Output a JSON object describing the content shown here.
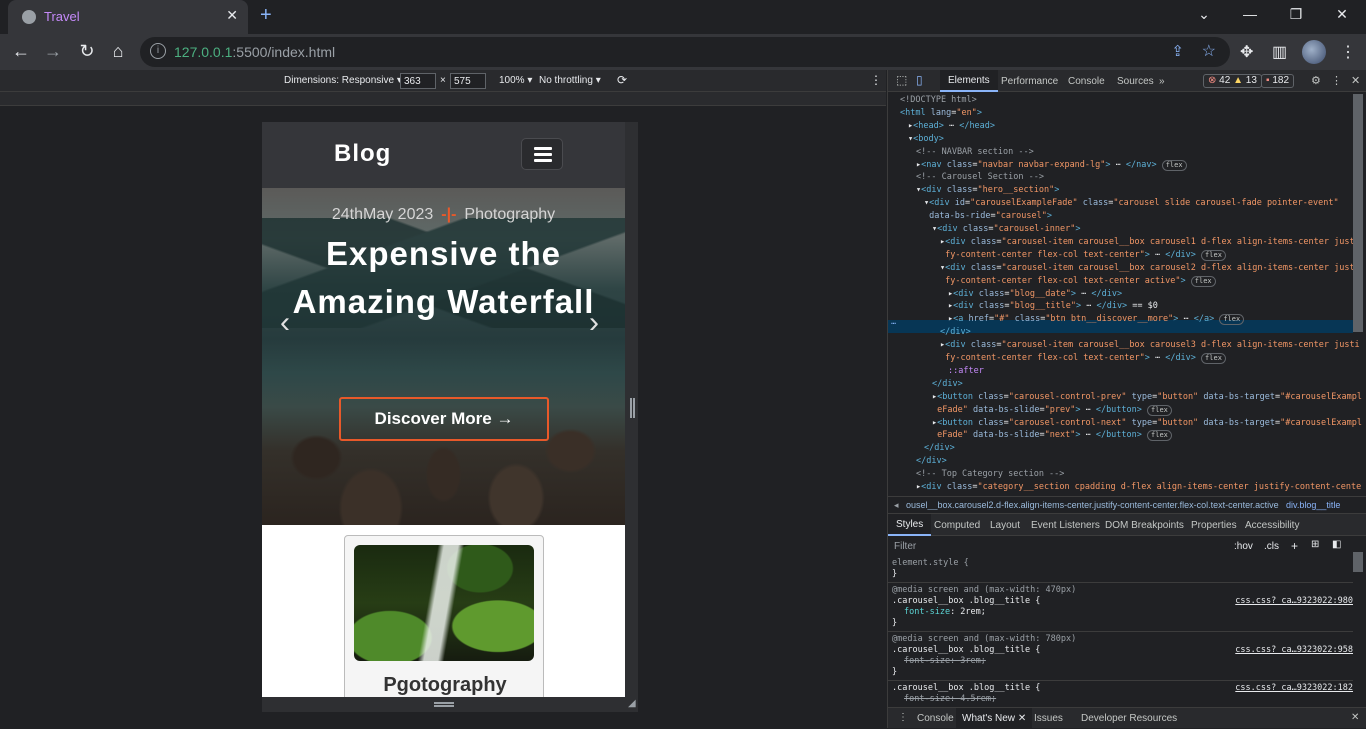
{
  "browser": {
    "tab_title": "Travel",
    "tab_close": "✕",
    "new_tab": "+",
    "url_host": "127.0.0.1",
    "url_rest": ":5500/index.html",
    "window_controls": [
      "⌄",
      "—",
      "❐",
      "✕"
    ]
  },
  "device_toolbar": {
    "dimensions_label": "Dimensions: Responsive ▾",
    "width": "363",
    "times": "×",
    "height": "575",
    "zoom": "100% ▾",
    "throttling": "No throttling ▾"
  },
  "page": {
    "brand": "Blog",
    "hero_date": "24thMay 2023",
    "hero_sep": "-|-",
    "hero_category": "Photography",
    "hero_title": "Expensive the Amazing Waterfall",
    "hero_button": "Discover More",
    "hero_button_arrow": "→",
    "prev": "‹",
    "next": "›",
    "card_title": "Pgotography"
  },
  "devtools": {
    "tabs": [
      "Elements",
      "Performance",
      "Console",
      "Sources",
      "»"
    ],
    "errors": "42",
    "warnings": "13",
    "issues": "182",
    "dom_lines": [
      {
        "i": 0,
        "html": "<span class='cm'>&lt;!DOCTYPE html&gt;</span>"
      },
      {
        "i": 0,
        "html": "<span class='tag'>&lt;html</span> <span class='attr'>lang</span>=<span class='val'>\"en\"</span><span class='tag'>&gt;</span>"
      },
      {
        "i": 1,
        "html": "▸<span class='tag'>&lt;head&gt;</span> ⋯ <span class='tag'>&lt;/head&gt;</span>"
      },
      {
        "i": 1,
        "html": "▾<span class='tag'>&lt;body&gt;</span>"
      },
      {
        "i": 2,
        "html": "<span class='cm'>&lt;!-- NAVBAR section --&gt;</span>"
      },
      {
        "i": 2,
        "html": "▸<span class='tag'>&lt;nav</span> <span class='attr'>class</span>=<span class='val'>\"navbar navbar-expand-lg\"</span><span class='tag'>&gt;</span> ⋯ <span class='tag'>&lt;/nav&gt;</span> <span class='flexb'>flex</span>"
      },
      {
        "i": 2,
        "html": "<span class='cm'>&lt;!-- Carousel Section --&gt;</span>"
      },
      {
        "i": 2,
        "html": "▾<span class='tag'>&lt;div</span> <span class='attr'>class</span>=<span class='val'>\"hero__section\"</span><span class='tag'>&gt;</span>"
      },
      {
        "i": 3,
        "html": "▾<span class='tag'>&lt;div</span> <span class='attr'>id</span>=<span class='val'>\"carouselExampleFade\"</span> <span class='attr'>class</span>=<span class='val'>\"carousel slide carousel-fade pointer-event\"</span>"
      },
      {
        "i": 3,
        "html": "&nbsp;<span class='attr'>data-bs-ride</span>=<span class='val'>\"carousel\"</span><span class='tag'>&gt;</span>"
      },
      {
        "i": 4,
        "html": "▾<span class='tag'>&lt;div</span> <span class='attr'>class</span>=<span class='val'>\"carousel-inner\"</span><span class='tag'>&gt;</span>"
      },
      {
        "i": 5,
        "html": "▸<span class='tag'>&lt;div</span> <span class='attr'>class</span>=<span class='val'>\"carousel-item carousel__box carousel1 d-flex align-items-center justi</span>"
      },
      {
        "i": 5,
        "html": "&nbsp;<span class='val'>fy-content-center flex-col text-center\"</span><span class='tag'>&gt;</span> ⋯ <span class='tag'>&lt;/div&gt;</span> <span class='flexb'>flex</span>"
      },
      {
        "i": 5,
        "html": "▾<span class='tag'>&lt;div</span> <span class='attr'>class</span>=<span class='val'>\"carousel-item carousel__box carousel2 d-flex align-items-center justi</span>"
      },
      {
        "i": 5,
        "html": "&nbsp;<span class='val'>fy-content-center flex-col text-center active\"</span><span class='tag'>&gt;</span> <span class='flexb'>flex</span>"
      },
      {
        "i": 6,
        "html": "▸<span class='tag'>&lt;div</span> <span class='attr'>class</span>=<span class='val'>\"blog__date\"</span><span class='tag'>&gt;</span> ⋯ <span class='tag'>&lt;/div&gt;</span>"
      },
      {
        "i": 6,
        "html": "▸<span class='tag'>&lt;div</span> <span class='attr'>class</span>=<span class='val'>\"blog__title\"</span><span class='tag'>&gt;</span> ⋯ <span class='tag'>&lt;/div&gt;</span> == <span style='color:#e8eaed'>$0</span>"
      },
      {
        "i": 6,
        "html": "▸<span class='tag'>&lt;a</span> <span class='attr'>href</span>=<span class='val'>\"#\"</span> <span class='attr'>class</span>=<span class='val'>\"btn btn__discover__more\"</span><span class='tag'>&gt;</span> ⋯ <span class='tag'>&lt;/a&gt;</span> <span class='flexb'>flex</span>"
      },
      {
        "i": 5,
        "html": "<span class='tag'>&lt;/div&gt;</span>"
      },
      {
        "i": 5,
        "html": "▸<span class='tag'>&lt;div</span> <span class='attr'>class</span>=<span class='val'>\"carousel-item carousel__box carousel3 d-flex align-items-center justi</span>"
      },
      {
        "i": 5,
        "html": "&nbsp;<span class='val'>fy-content-center flex-col text-center\"</span><span class='tag'>&gt;</span> ⋯ <span class='tag'>&lt;/div&gt;</span> <span class='flexb'>flex</span>"
      },
      {
        "i": 6,
        "html": "<span style='color:#c58af9'>::after</span>"
      },
      {
        "i": 4,
        "html": "<span class='tag'>&lt;/div&gt;</span>"
      },
      {
        "i": 4,
        "html": "▸<span class='tag'>&lt;button</span> <span class='attr'>class</span>=<span class='val'>\"carousel-control-prev\"</span> <span class='attr'>type</span>=<span class='val'>\"button\"</span> <span class='attr'>data-bs-target</span>=<span class='val'>\"#carouselExampl</span>"
      },
      {
        "i": 4,
        "html": "&nbsp;<span class='val'>eFade\"</span> <span class='attr'>data-bs-slide</span>=<span class='val'>\"prev\"</span><span class='tag'>&gt;</span> ⋯ <span class='tag'>&lt;/button&gt;</span> <span class='flexb'>flex</span>"
      },
      {
        "i": 4,
        "html": "▸<span class='tag'>&lt;button</span> <span class='attr'>class</span>=<span class='val'>\"carousel-control-next\"</span> <span class='attr'>type</span>=<span class='val'>\"button\"</span> <span class='attr'>data-bs-target</span>=<span class='val'>\"#carouselExampl</span>"
      },
      {
        "i": 4,
        "html": "&nbsp;<span class='val'>eFade\"</span> <span class='attr'>data-bs-slide</span>=<span class='val'>\"next\"</span><span class='tag'>&gt;</span> ⋯ <span class='tag'>&lt;/button&gt;</span> <span class='flexb'>flex</span>"
      },
      {
        "i": 3,
        "html": "<span class='tag'>&lt;/div&gt;</span>"
      },
      {
        "i": 2,
        "html": "<span class='tag'>&lt;/div&gt;</span>"
      },
      {
        "i": 2,
        "html": "<span class='cm'>&lt;!-- Top Category section --&gt;</span>"
      },
      {
        "i": 2,
        "html": "▸<span class='tag'>&lt;div</span> <span class='attr'>class</span>=<span class='val'>\"category__section cpadding d-flex align-items-center justify-content-cente</span>"
      }
    ],
    "breadcrumb_left": "◂",
    "breadcrumb_path": "ousel__box.carousel2.d-flex.align-items-center.justify-content-center.flex-col.text-center.active",
    "breadcrumb_current": "div.blog__title",
    "styles_tabs": [
      "Styles",
      "Computed",
      "Layout",
      "Event Listeners",
      "DOM Breakpoints",
      "Properties",
      "Accessibility"
    ],
    "filter_placeholder": "Filter",
    "filter_hov": ":hov",
    "filter_cls": ".cls",
    "rules": {
      "element_style": "element.style {",
      "close": "}",
      "r1_media": "@media screen and (max-width: 470px)",
      "r1_selector": ".carousel__box .blog__title {",
      "r1_prop": "font-size",
      "r1_value": ": 2rem;",
      "r1_link": "css.css?_ca…9323022:980",
      "r2_media": "@media screen and (max-width: 780px)",
      "r2_selector": ".carousel__box .blog__title {",
      "r2_prop": "font-size: 3rem;",
      "r2_link": "css.css?_ca…9323022:958",
      "r3_selector": ".carousel__box .blog__title {",
      "r3_prop": "font-size: 4.5rem;",
      "r3_link": "css.css?_ca…9323022:182"
    },
    "drawer_tabs": [
      "Console",
      "What's New",
      "Issues",
      "Developer Resources"
    ],
    "drawer_close": "✕"
  }
}
